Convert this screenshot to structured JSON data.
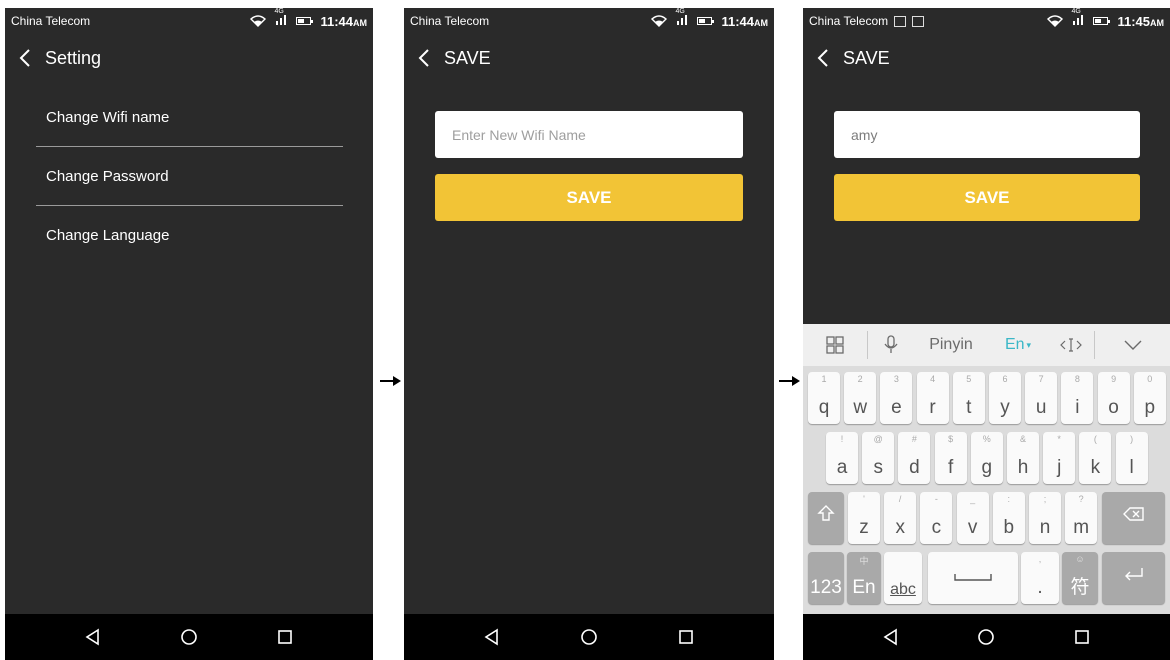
{
  "status": {
    "carrier": "China Telecom",
    "network": "4G",
    "time1": "11:44",
    "time2": "11:44",
    "time3": "11:45",
    "ampm": "AM"
  },
  "screen1": {
    "title": "Setting",
    "items": [
      "Change Wifi name",
      "Change Password",
      "Change Language"
    ]
  },
  "screen2": {
    "title": "SAVE",
    "input_placeholder": "Enter New Wifi Name",
    "save_label": "SAVE"
  },
  "screen3": {
    "title": "SAVE",
    "input_value": "amy",
    "save_label": "SAVE"
  },
  "keyboard": {
    "toolbar": {
      "pinyin": "Pinyin",
      "en": "En"
    },
    "row1": [
      {
        "main": "q",
        "sub": "1"
      },
      {
        "main": "w",
        "sub": "2"
      },
      {
        "main": "e",
        "sub": "3"
      },
      {
        "main": "r",
        "sub": "4"
      },
      {
        "main": "t",
        "sub": "5"
      },
      {
        "main": "y",
        "sub": "6"
      },
      {
        "main": "u",
        "sub": "7"
      },
      {
        "main": "i",
        "sub": "8"
      },
      {
        "main": "o",
        "sub": "9"
      },
      {
        "main": "p",
        "sub": "0"
      }
    ],
    "row2": [
      {
        "main": "a",
        "sub": "!"
      },
      {
        "main": "s",
        "sub": "@"
      },
      {
        "main": "d",
        "sub": "#"
      },
      {
        "main": "f",
        "sub": "$"
      },
      {
        "main": "g",
        "sub": "%"
      },
      {
        "main": "h",
        "sub": "&"
      },
      {
        "main": "j",
        "sub": "*"
      },
      {
        "main": "k",
        "sub": "("
      },
      {
        "main": "l",
        "sub": ")"
      }
    ],
    "row3": [
      {
        "main": "z",
        "sub": "'"
      },
      {
        "main": "x",
        "sub": "/"
      },
      {
        "main": "c",
        "sub": "-"
      },
      {
        "main": "v",
        "sub": "_"
      },
      {
        "main": "b",
        "sub": ":"
      },
      {
        "main": "n",
        "sub": ";"
      },
      {
        "main": "m",
        "sub": "?"
      }
    ],
    "num_key": "123",
    "en_key": "En",
    "en_key_sub": "中",
    "abc_key": "abc",
    "period_key": ".",
    "period_sub": ",",
    "sym_key": "符",
    "sym_sub": "☺"
  },
  "colors": {
    "screen_bg": "#2a2a2a",
    "accent": "#f2c436",
    "toolbar_en": "#3bb7c7"
  }
}
